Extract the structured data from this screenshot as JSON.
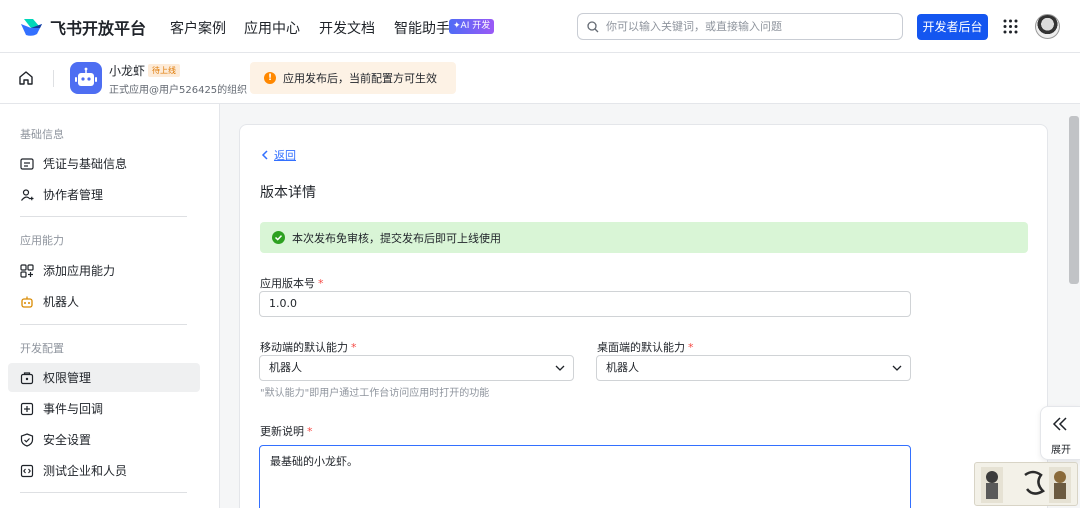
{
  "topnav": {
    "brand": "飞书开放平台",
    "links": [
      "客户案例",
      "应用中心",
      "开发文档",
      "智能助手"
    ],
    "ai_badge": "✦AI 开发",
    "search_placeholder": "你可以输入关键词，或直接输入问题",
    "dev_console": "开发者后台"
  },
  "app": {
    "name": "小龙虾",
    "status": "待上线",
    "subtitle": "正式应用@用户526425的组织",
    "notice": "应用发布后，当前配置方可生效"
  },
  "sidebar": {
    "groups": [
      {
        "label": "基础信息",
        "items": [
          "凭证与基础信息",
          "协作者管理"
        ]
      },
      {
        "label": "应用能力",
        "items": [
          "添加应用能力",
          "机器人"
        ]
      },
      {
        "label": "开发配置",
        "items": [
          "权限管理",
          "事件与回调",
          "安全设置",
          "测试企业和人员"
        ]
      }
    ],
    "active_item": "权限管理"
  },
  "main": {
    "back": "返回",
    "title": "版本详情",
    "success": "本次发布免审核，提交发布后即可上线使用",
    "version_label": "应用版本号",
    "version_value": "1.0.0",
    "mobile_label": "移动端的默认能力",
    "mobile_value": "机器人",
    "desktop_label": "桌面端的默认能力",
    "desktop_value": "机器人",
    "hint": "\"默认能力\"即用户通过工作台访问应用时打开的功能",
    "notes_label": "更新说明",
    "notes_value": "最基础的小龙虾。",
    "required_mark": "*"
  },
  "expand": {
    "label": "展开"
  },
  "colors": {
    "primary": "#1456f0",
    "link": "#3370ff",
    "success_bg": "#d9f5d6",
    "warning": "#ff8800",
    "required": "#f54a45"
  }
}
